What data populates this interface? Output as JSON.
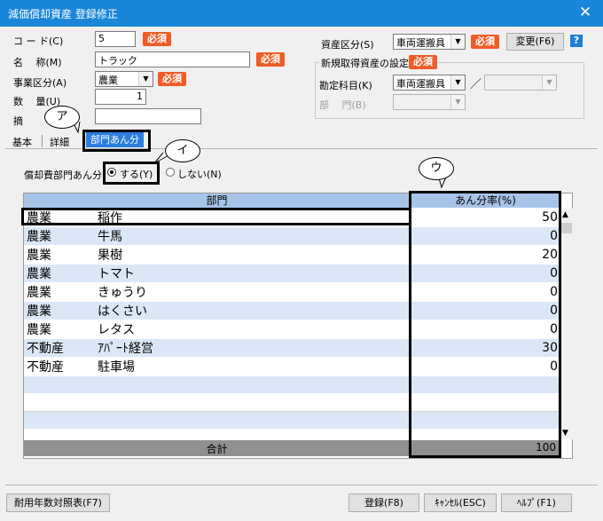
{
  "window": {
    "title": "減価償却資産 登録修正",
    "close": "✕"
  },
  "fields": {
    "code": {
      "label": "コ ー ド(C)",
      "value": "5"
    },
    "name": {
      "label": "名　 称(M)",
      "value": "トラック"
    },
    "business": {
      "label": "事業区分(A)",
      "value": "農業"
    },
    "quantity": {
      "label": "数　 量(U)",
      "value": "1"
    },
    "summary": {
      "label": "摘",
      "value": ""
    },
    "required": "必須"
  },
  "asset": {
    "label": "資産区分(S)",
    "value": "車両運搬具",
    "change_button": "変更(F6)",
    "help": "?",
    "group_title": "新規取得資産の設定",
    "account_label": "勘定科目(K)",
    "account_value": "車両運搬具",
    "slash": "／",
    "dept_label": "部　 門(B)"
  },
  "tabs": [
    {
      "label": "基本"
    },
    {
      "label": "詳細"
    },
    {
      "label": "部門あん分"
    }
  ],
  "allocation": {
    "label": "償却費部門あん分",
    "yes": "する(Y)",
    "no": "しない(N)",
    "selected": "yes"
  },
  "grid": {
    "header_dept": "部門",
    "header_rate": "あん分率(%)",
    "rows": [
      {
        "category": "農業",
        "name": "稲作",
        "rate": "50"
      },
      {
        "category": "農業",
        "name": "牛馬",
        "rate": "0"
      },
      {
        "category": "農業",
        "name": "果樹",
        "rate": "20"
      },
      {
        "category": "農業",
        "name": "トマト",
        "rate": "0"
      },
      {
        "category": "農業",
        "name": "きゅうり",
        "rate": "0"
      },
      {
        "category": "農業",
        "name": "はくさい",
        "rate": "0"
      },
      {
        "category": "農業",
        "name": "レタス",
        "rate": "0"
      },
      {
        "category": "不動産",
        "name": "ｱﾊﾟｰﾄ経営",
        "rate": "30"
      },
      {
        "category": "不動産",
        "name": "駐車場",
        "rate": "0"
      }
    ],
    "empty_rows": 4,
    "total_label": "合計",
    "total_value": "100"
  },
  "callouts": {
    "a": "ア",
    "i": "イ",
    "u": "ウ"
  },
  "buttons": {
    "lifetime_table": "耐用年数対照表(F7)",
    "register": "登録(F8)",
    "cancel": "ｷｬﾝｾﾙ(ESC)",
    "help": "ﾍﾙﾌﾟ(F1)"
  }
}
